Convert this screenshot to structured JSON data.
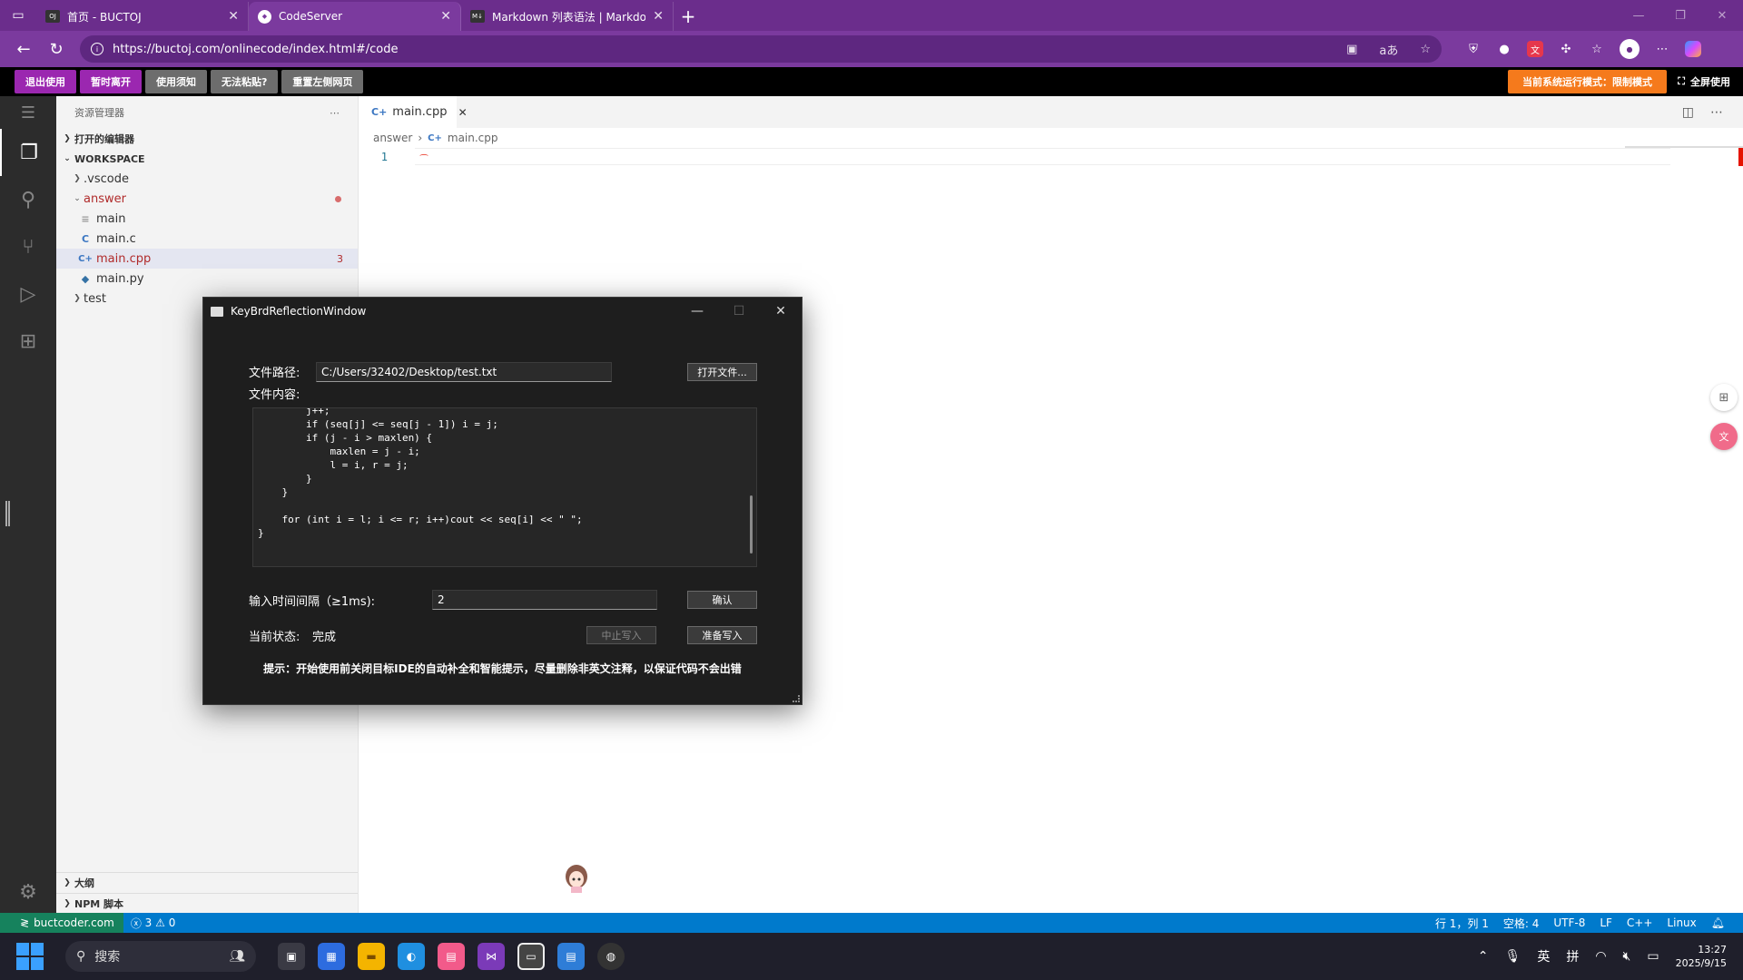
{
  "browser": {
    "tabs": [
      {
        "title": "首页 - BUCTOJ",
        "favicon": "buctoj"
      },
      {
        "title": "CodeServer",
        "favicon": "codeserver",
        "active": true
      },
      {
        "title": "Markdown 列表语法 | Markdown",
        "favicon": "markdown"
      }
    ],
    "url": "https://buctoj.com/onlinecode/index.html#/code"
  },
  "toolbar": {
    "buttons": [
      "退出使用",
      "暂时离开",
      "使用须知",
      "无法粘贴?",
      "重置左侧网页"
    ],
    "mode_badge": "当前系统运行模式：限制模式",
    "fullscreen_label": "全屏使用",
    "colors": {
      "purple": "#9b27b0",
      "grey": "#6d6d6d",
      "orange": "#f57a1c"
    }
  },
  "explorer": {
    "title": "资源管理器",
    "open_editors": "打开的编辑器",
    "workspace": "WORKSPACE",
    "items": [
      {
        "name": ".vscode",
        "type": "folder"
      },
      {
        "name": "answer",
        "type": "folder-open"
      },
      {
        "name": "main",
        "type": "file"
      },
      {
        "name": "main.c",
        "type": "c",
        "icon_label": "C"
      },
      {
        "name": "main.cpp",
        "type": "cpp",
        "icon_label": "C+",
        "badge": "3"
      },
      {
        "name": "main.py",
        "type": "py"
      },
      {
        "name": "test",
        "type": "folder"
      }
    ],
    "outline": "大纲",
    "npm_scripts": "NPM 脚本"
  },
  "editor": {
    "tab": "main.cpp",
    "breadcrumb": [
      "answer",
      "main.cpp"
    ],
    "line_number": "1"
  },
  "statusbar": {
    "remote": "buctcoder.com",
    "errors": "3",
    "warnings": "0",
    "position": "行 1，列 1",
    "spaces": "空格: 4",
    "encoding": "UTF-8",
    "eol": "LF",
    "language": "C++",
    "os": "Linux"
  },
  "dialog": {
    "title": "KeyBrdReflectionWindow",
    "file_path_label": "文件路径:",
    "file_path": "C:/Users/32402/Desktop/test.txt",
    "open_file_button": "打开文件...",
    "content_label": "文件内容:",
    "content": "        j++;\n        if (seq[j] <= seq[j - 1]) i = j;\n        if (j - i > maxlen) {\n            maxlen = j - i;\n            l = i, r = j;\n        }\n    }\n\n    for (int i = l; i <= r; i++)cout << seq[i] << \" \";\n}",
    "interval_label": "输入时间间隔（≥1ms):",
    "interval_value": "2",
    "confirm_button": "确认",
    "status_label": "当前状态:",
    "status_value": "完成",
    "stop_button": "中止写入",
    "prepare_button": "准备写入",
    "hint": "提示：开始使用前关闭目标IDE的自动补全和智能提示，尽量删除非英文注释，以保证代码不会出错"
  },
  "taskbar": {
    "search_placeholder": "搜索",
    "tray": {
      "ime_lang": "英",
      "ime_mode": "拼"
    },
    "time": "13:27",
    "date": "2025/9/15"
  }
}
